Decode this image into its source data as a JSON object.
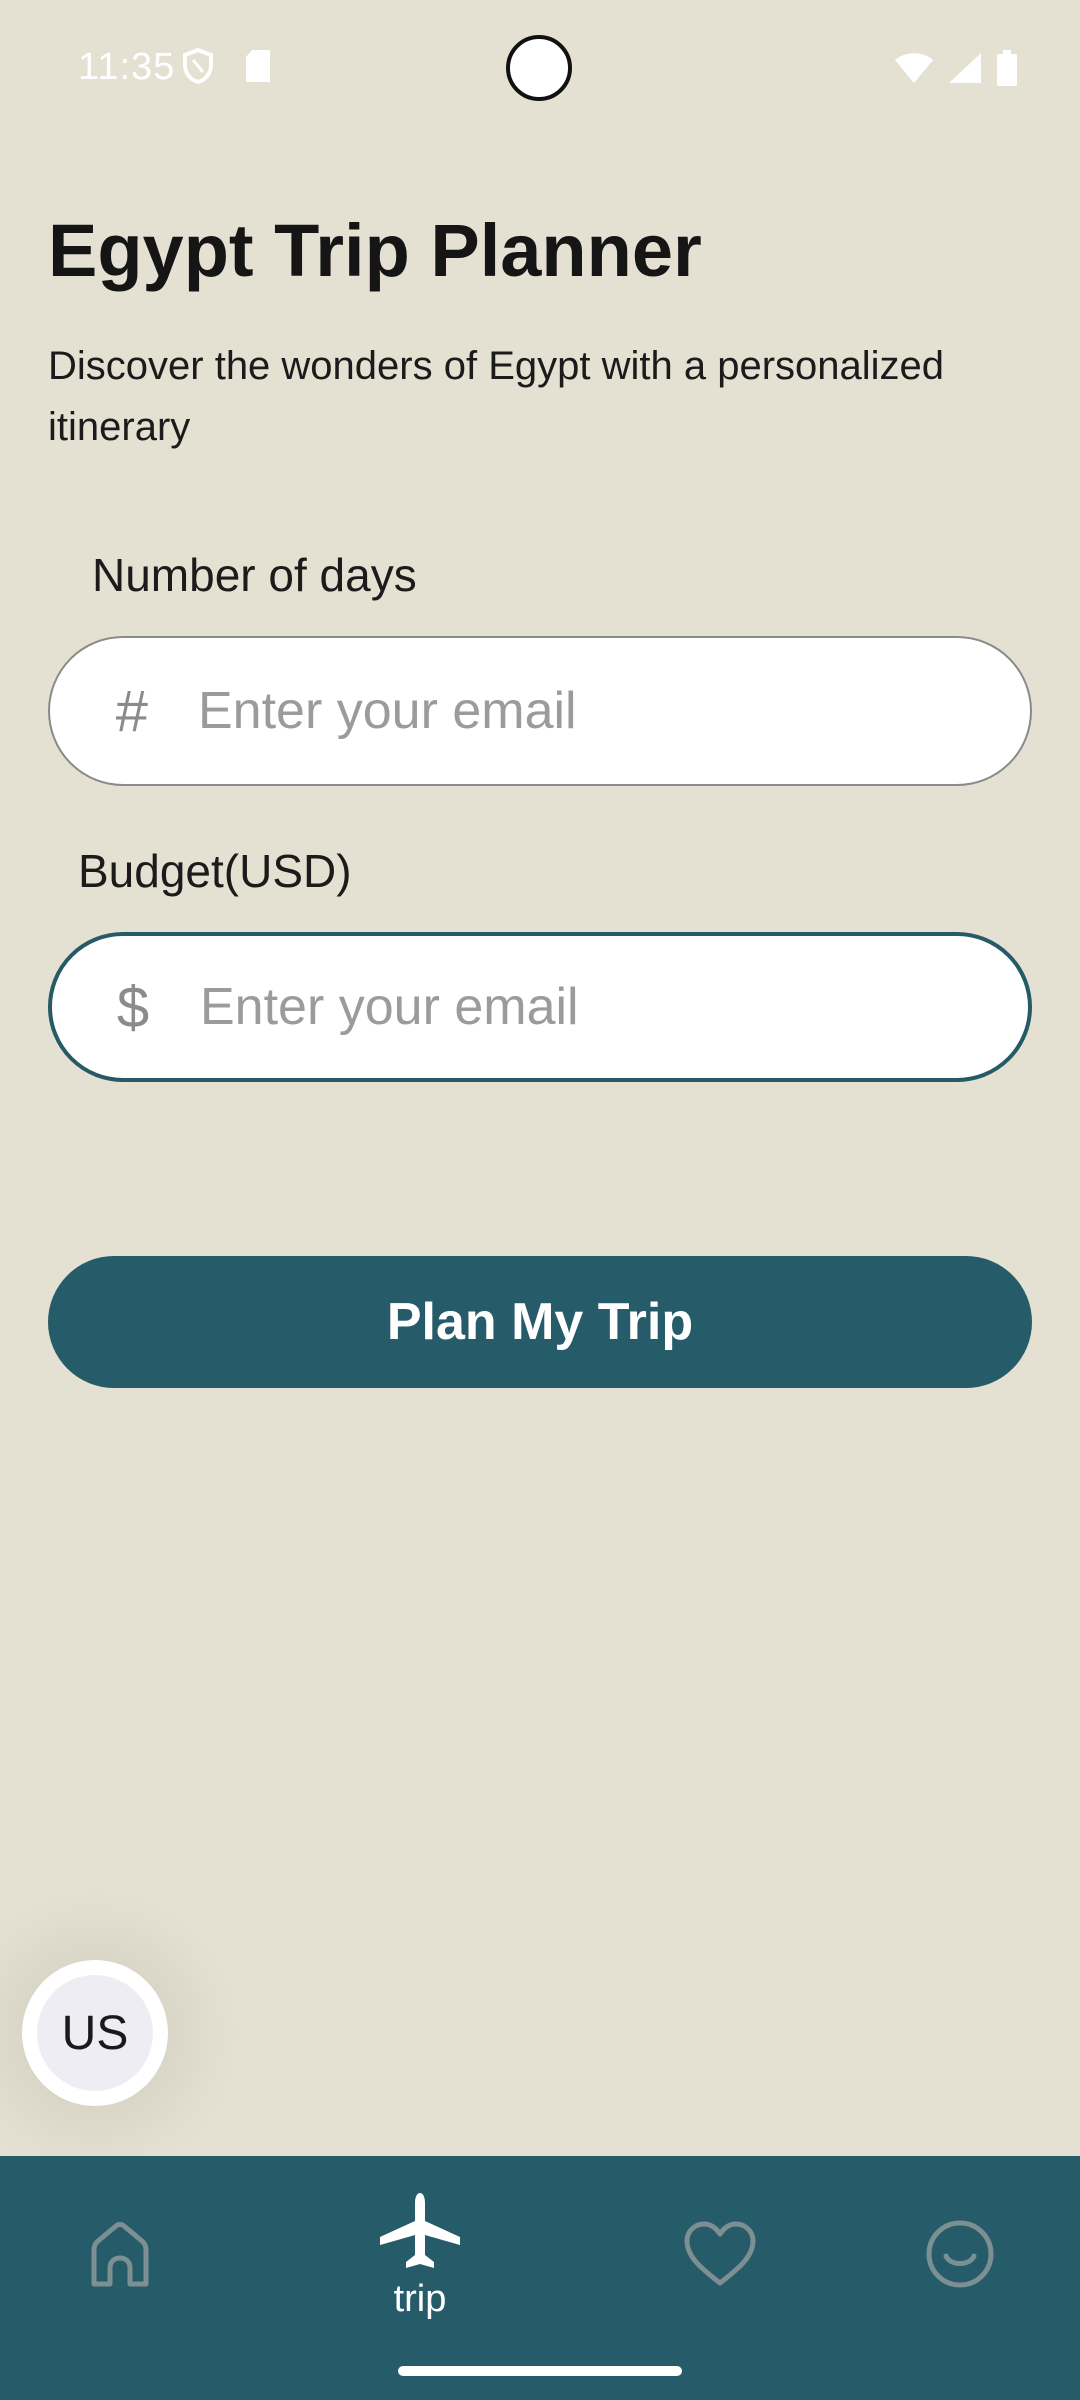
{
  "status_bar": {
    "time": "11:35"
  },
  "header": {
    "title": "Egypt Trip Planner",
    "subtitle": "Discover the wonders of Egypt with a personalized itinerary"
  },
  "form": {
    "days": {
      "label": "Number of days",
      "prefix": "#",
      "placeholder": "Enter your email",
      "value": ""
    },
    "budget": {
      "label": "Budget(USD)",
      "prefix": "$",
      "placeholder": "Enter your email",
      "value": ""
    },
    "submit_label": "Plan My Trip"
  },
  "language_bubble": {
    "label": "US"
  },
  "bottom_nav": {
    "items": [
      {
        "icon": "home-icon",
        "label": ""
      },
      {
        "icon": "airplane-icon",
        "label": "trip"
      },
      {
        "icon": "heart-icon",
        "label": ""
      },
      {
        "icon": "smile-icon",
        "label": ""
      }
    ],
    "active_index": 1
  },
  "colors": {
    "background": "#e4e1d2",
    "accent": "#265c69",
    "inactive_icon": "#7c8f92"
  }
}
